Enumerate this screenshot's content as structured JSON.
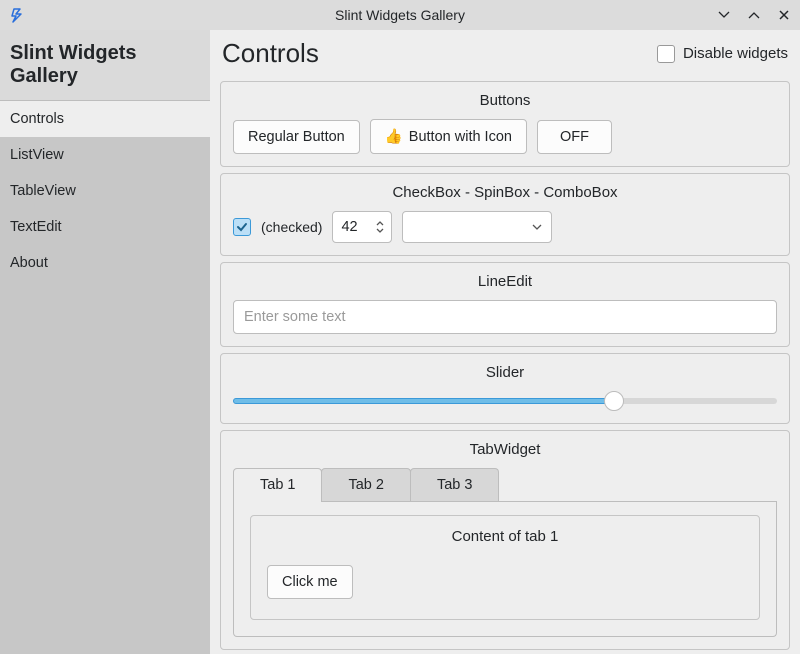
{
  "window": {
    "title": "Slint Widgets Gallery"
  },
  "sidebar": {
    "title": "Slint Widgets Gallery",
    "items": [
      {
        "label": "Controls",
        "active": true
      },
      {
        "label": "ListView",
        "active": false
      },
      {
        "label": "TableView",
        "active": false
      },
      {
        "label": "TextEdit",
        "active": false
      },
      {
        "label": "About",
        "active": false
      }
    ]
  },
  "header": {
    "title": "Controls",
    "disable_label": "Disable widgets",
    "disable_checked": false
  },
  "panels": {
    "buttons": {
      "title": "Buttons",
      "items": {
        "regular": "Regular Button",
        "with_icon": "Button with Icon",
        "with_icon_emoji": "👍",
        "off": "OFF"
      }
    },
    "checkbox_spin_combo": {
      "title": "CheckBox - SpinBox - ComboBox",
      "checkbox_label": "(checked)",
      "checkbox_checked": true,
      "spinbox_value": "42",
      "combobox_value": ""
    },
    "lineedit": {
      "title": "LineEdit",
      "placeholder": "Enter some text",
      "value": ""
    },
    "slider": {
      "title": "Slider",
      "percent": 70
    },
    "tabwidget": {
      "title": "TabWidget",
      "tabs": [
        {
          "label": "Tab 1",
          "active": true
        },
        {
          "label": "Tab 2",
          "active": false
        },
        {
          "label": "Tab 3",
          "active": false
        }
      ],
      "content_title": "Content of tab 1",
      "button_label": "Click me"
    }
  }
}
